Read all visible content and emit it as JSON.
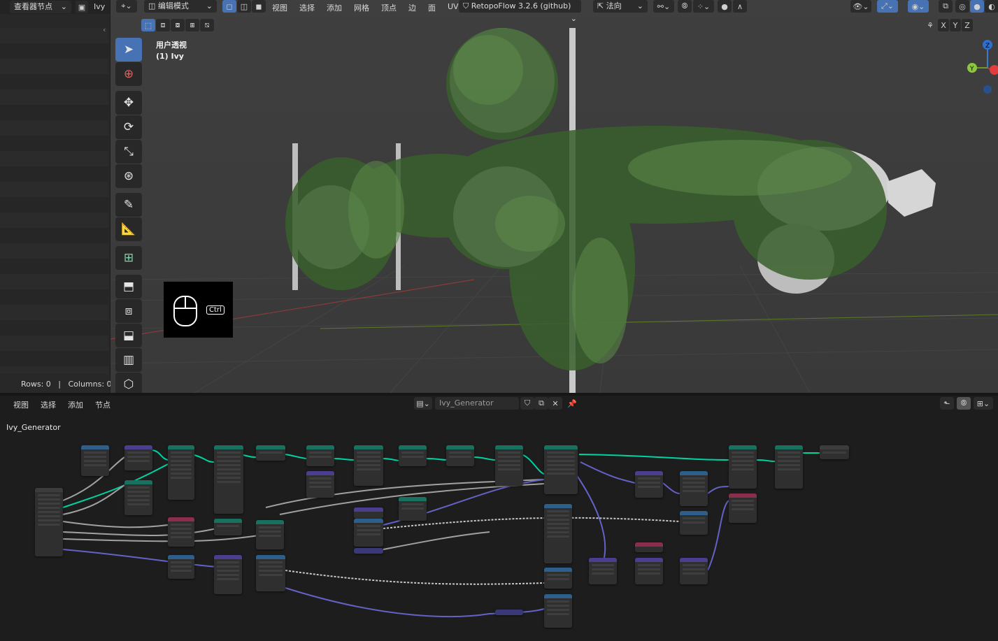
{
  "outliner": {
    "editor_type": "查看器节点",
    "object": "Ivy",
    "status": "Rows: 0   |   Columns: 0"
  },
  "viewport_header": {
    "mode": "编辑模式",
    "menus": [
      "视图",
      "选择",
      "添加",
      "网格",
      "顶点",
      "边",
      "面",
      "UV"
    ],
    "addon": "RetopoFlow 3.2.6 (github)",
    "orientation": "法向"
  },
  "viewport": {
    "view_name": "用户透视",
    "object_label": "(1) Ivy",
    "axes": [
      "X",
      "Y",
      "Z"
    ],
    "key_overlay": "Ctrl"
  },
  "tools": [
    "select-box-tool",
    "cursor-tool",
    "move-tool",
    "rotate-tool",
    "scale-tool",
    "transform-tool",
    "annotate-tool",
    "measure-tool",
    "add-cube-tool",
    "extrude-tool",
    "inset-tool",
    "bevel-tool",
    "loop-cut-tool",
    "knife-tool"
  ],
  "node_editor": {
    "menus": [
      "视图",
      "选择",
      "添加",
      "节点"
    ],
    "tree_name": "Ivy_Generator",
    "breadcrumb": "Ivy_Generator"
  },
  "colors": {
    "accent": "#4772b3",
    "geometry_link": "#00d4a3",
    "vector_link": "#6363c7",
    "float_link": "#a1a1a1"
  }
}
